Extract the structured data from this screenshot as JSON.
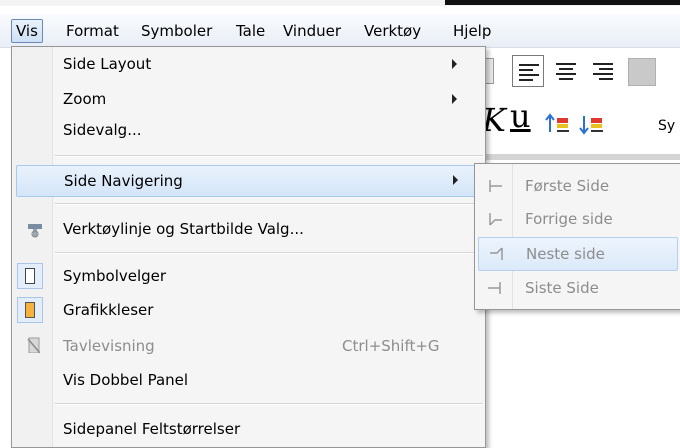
{
  "menubar": {
    "items": [
      "Vis",
      "Format",
      "Symboler",
      "Tale",
      "Vinduer",
      "Verktøy",
      "Hjelp"
    ],
    "active_index": 0
  },
  "toolbar": {
    "italic_glyph": "K",
    "underline_glyph": "u",
    "partial_label": "Sy"
  },
  "menu": {
    "side_layout": "Side Layout",
    "zoom": "Zoom",
    "sidevalg": "Sidevalg...",
    "side_navigering": "Side Navigering",
    "verktoylinje": "Verktøylinje og Startbilde Valg...",
    "symbolvelger": "Symbolvelger",
    "grafikkleser": "Grafikkleser",
    "tavlevisning": "Tavlevisning",
    "tavlevisning_shortcut": "Ctrl+Shift+G",
    "vis_dobbel_panel": "Vis Dobbel Panel",
    "sidepanel": "Sidepanel Feltstørrelser"
  },
  "submenu": {
    "forste_side": "Første Side",
    "forrige_side": "Forrige side",
    "neste_side": "Neste side",
    "siste_side": "Siste Side"
  }
}
